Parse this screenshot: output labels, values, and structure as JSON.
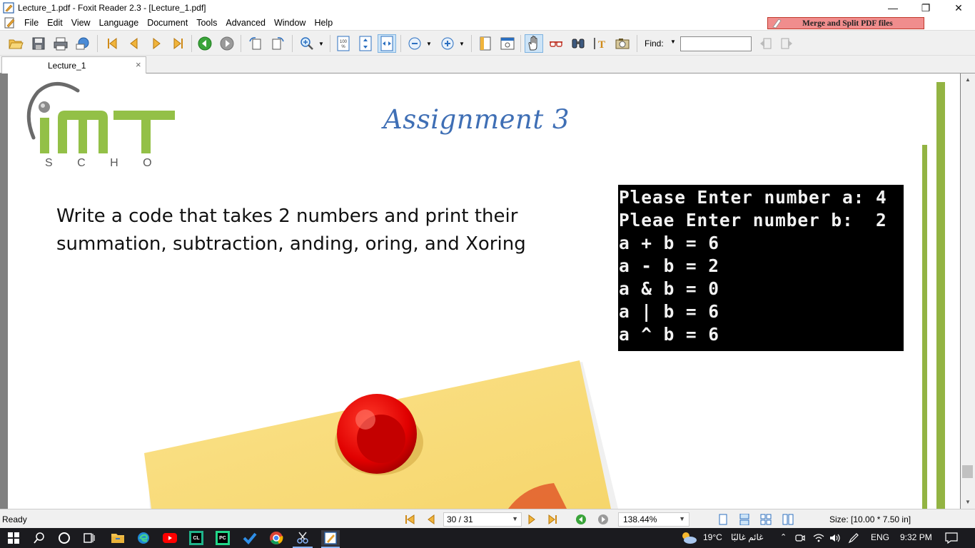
{
  "window": {
    "title": "Lecture_1.pdf - Foxit Reader 2.3 - [Lecture_1.pdf]",
    "minimize_glyph": "—",
    "restore_glyph": "❐",
    "close_glyph": "✕"
  },
  "menu": {
    "items": [
      "File",
      "Edit",
      "View",
      "Language",
      "Document",
      "Tools",
      "Advanced",
      "Window",
      "Help"
    ],
    "promo_label": "Merge and Split PDF files"
  },
  "toolbar": {
    "find_label": "Find:",
    "find_value": "",
    "icons": [
      "open-icon",
      "save-icon",
      "print-icon",
      "email-icon",
      "first-page-icon",
      "previous-page-icon",
      "next-page-icon",
      "last-page-icon",
      "go-back-icon",
      "go-forward-icon",
      "rotate-left-icon",
      "rotate-right-icon",
      "zoom-in-icon",
      "actual-size-icon",
      "fit-page-icon",
      "fit-width-icon",
      "zoom-out-button-icon",
      "zoom-in-button-icon",
      "bookmark-icon",
      "full-screen-icon",
      "hand-tool-icon",
      "reading-glasses-icon",
      "find-binoculars-icon",
      "select-text-icon",
      "snapshot-icon",
      "find-previous-icon",
      "find-next-icon"
    ]
  },
  "tabs": [
    {
      "label": "Lecture_1",
      "close": "×"
    }
  ],
  "page": {
    "logo_word": "iMT",
    "logo_sub": "S C H O O L",
    "title": "Assignment 3",
    "question_line1": "Write a code that takes 2 numbers and print their",
    "question_line2": "summation, subtraction, anding, oring, and Xoring",
    "console_lines": [
      "Please Enter number a: 4",
      "Pleae Enter number b:  2",
      "a + b = 6",
      "a - b = 2",
      "a & b = 0",
      "a | b = 6",
      "a ^ b = 6"
    ]
  },
  "status": {
    "ready": "Ready",
    "page_indicator": "30 / 31",
    "zoom": "138.44%",
    "page_size": "Size: [10.00 * 7.50 in]"
  },
  "taskbar": {
    "weather": "19°C",
    "weather_desc": "غائم غالبًا",
    "language": "ENG",
    "time": "9:32 PM"
  },
  "colors": {
    "logo_green": "#93c047",
    "title_blue": "#3f6fb5",
    "console_bg": "#000000",
    "accent_bar": "#93b443"
  }
}
